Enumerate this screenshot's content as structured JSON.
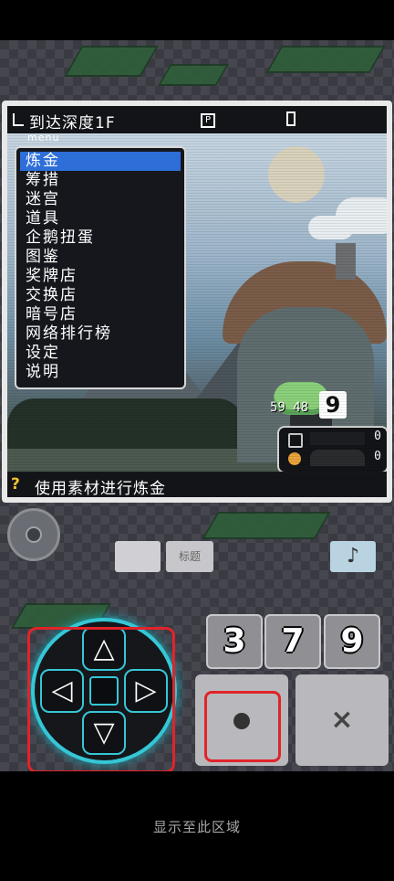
{
  "title_bar": {
    "depth_text": "到达深度1F",
    "p_icon": "P"
  },
  "menu": {
    "header": "menu",
    "items": [
      {
        "label": "炼金",
        "selected": true
      },
      {
        "label": "筹措"
      },
      {
        "label": "迷宫"
      },
      {
        "label": "道具"
      },
      {
        "label": "企鹅扭蛋"
      },
      {
        "label": "图鉴"
      },
      {
        "label": "奖牌店"
      },
      {
        "label": "交换店"
      },
      {
        "label": "暗号店"
      },
      {
        "label": "网络排行榜"
      },
      {
        "label": "设定"
      },
      {
        "label": "说明"
      }
    ]
  },
  "creature": {
    "stats": "59 48",
    "level": "9"
  },
  "resources": {
    "value1": "0",
    "value2": "0"
  },
  "status": {
    "icon": "?",
    "message": "使用素材进行炼金"
  },
  "controls": {
    "title_button": "标题",
    "music_icon": "♪",
    "number_keys": [
      "3",
      "7",
      "9"
    ],
    "cancel_symbol": "×"
  },
  "dpad": {
    "up": "△",
    "down": "▽",
    "left": "◁",
    "right": "▷"
  },
  "bottom_text": "显示至此区域",
  "colors": {
    "accent": "#35c7d6",
    "highlight": "#e0242a",
    "menu_select": "#2d6ed8"
  }
}
